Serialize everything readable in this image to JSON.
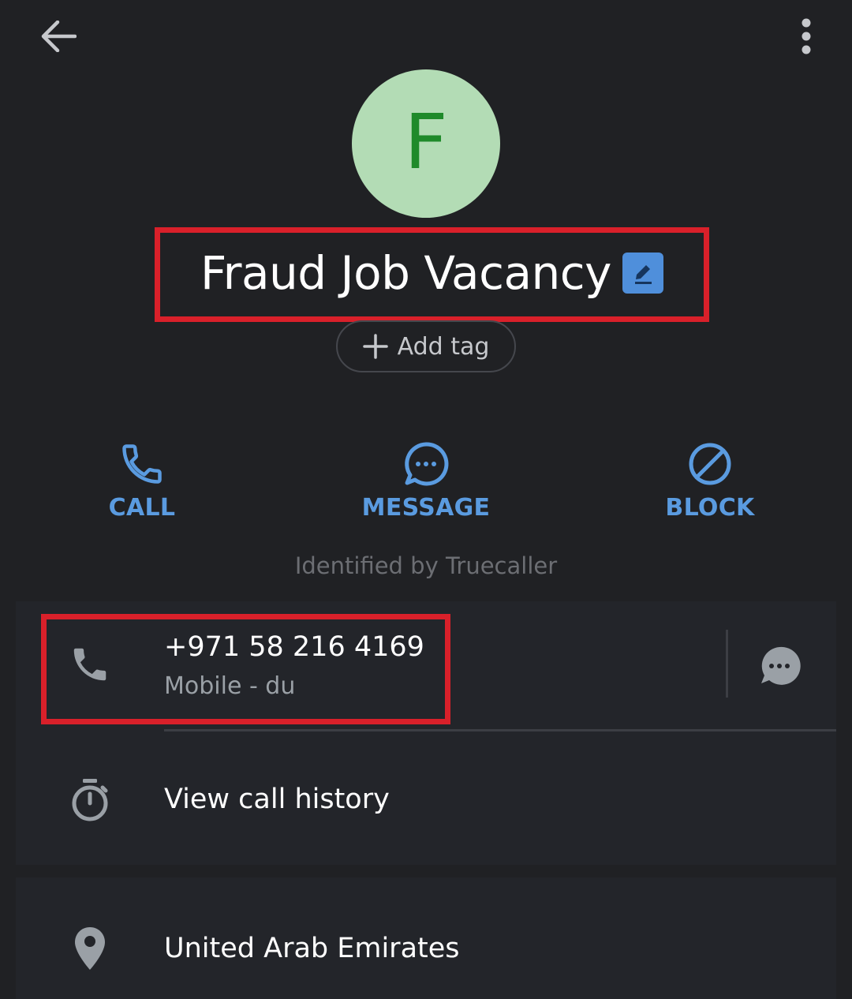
{
  "contact": {
    "avatar_letter": "F",
    "name": "Fraud Job Vacancy",
    "add_tag_label": "Add tag",
    "identified_by": "Identified by Truecaller"
  },
  "actions": {
    "call_label": "CALL",
    "message_label": "MESSAGE",
    "block_label": "BLOCK"
  },
  "phone": {
    "number": "+971 58 216 4169",
    "type": "Mobile - du"
  },
  "rows": {
    "call_history": "View call history",
    "location": "United Arab Emirates"
  },
  "colors": {
    "background": "#202124",
    "accent": "#5a9be0",
    "avatar_bg": "#b3dcb5",
    "avatar_letter": "#1f8a2a",
    "highlight": "#d9202a"
  },
  "icons": {
    "back": "arrow-left-icon",
    "more": "more-vertical-icon",
    "edit": "pencil-icon",
    "add": "plus-icon",
    "call": "phone-icon",
    "message": "message-bubble-icon",
    "block": "block-icon",
    "phone_row": "phone-icon",
    "sms": "sms-bubble-icon",
    "history": "stopwatch-icon",
    "location": "location-pin-icon"
  }
}
